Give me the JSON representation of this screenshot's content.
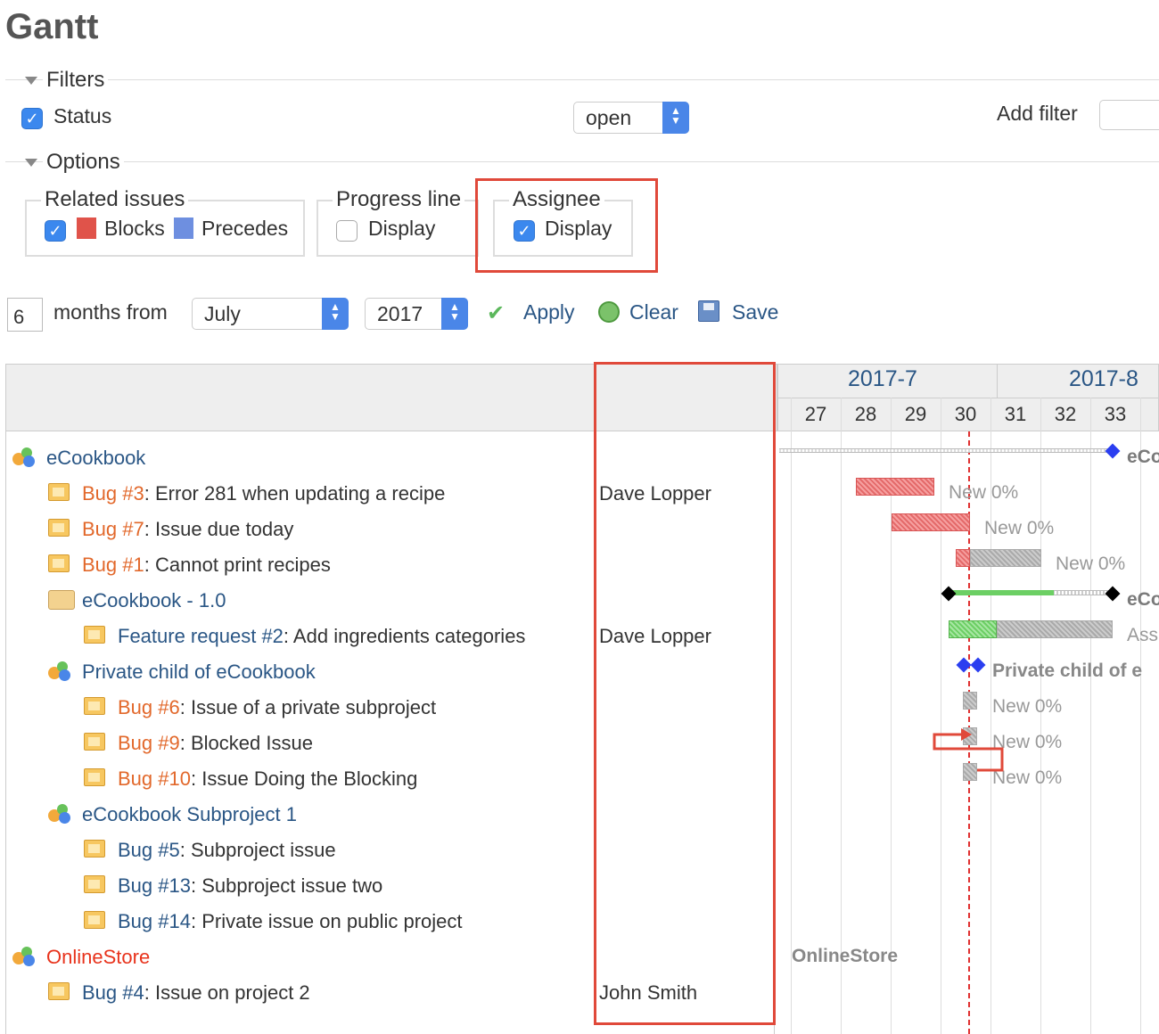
{
  "page": {
    "title": "Gantt"
  },
  "filters": {
    "legend": "Filters",
    "status_label": "Status",
    "status_operator": "open",
    "add_filter_label": "Add filter"
  },
  "options": {
    "legend": "Options",
    "related_issues": {
      "legend": "Related issues",
      "blocks": "Blocks",
      "precedes": "Precedes"
    },
    "progress_line": {
      "legend": "Progress line",
      "display": "Display"
    },
    "assignee": {
      "legend": "Assignee",
      "display": "Display"
    }
  },
  "period": {
    "months": "6",
    "months_from_label": "months from",
    "month": "July",
    "year": "2017"
  },
  "actions": {
    "apply": "Apply",
    "clear": "Clear",
    "save": "Save"
  },
  "gantt": {
    "months": [
      "2017-7",
      "2017-8"
    ],
    "weeks": [
      "27",
      "28",
      "29",
      "30",
      "31",
      "32",
      "33",
      "3"
    ],
    "rows": [
      {
        "type": "project",
        "name": "eCookbook",
        "assignee": ""
      },
      {
        "type": "issue",
        "tracker": "Bug",
        "number": "#3",
        "subject": ": Error 281 when updating a recipe",
        "assignee": "Dave Lopper"
      },
      {
        "type": "issue",
        "tracker": "Bug",
        "number": "#7",
        "subject": ": Issue due today",
        "assignee": ""
      },
      {
        "type": "issue",
        "tracker": "Bug",
        "number": "#1",
        "subject": ": Cannot print recipes",
        "assignee": ""
      },
      {
        "type": "version",
        "name": "eCookbook - 1.0",
        "assignee": ""
      },
      {
        "type": "issue",
        "tracker": "Feature request",
        "number": "#2",
        "subject": ": Add ingredients categories",
        "assignee": "Dave Lopper"
      },
      {
        "type": "project",
        "name": "Private child of eCookbook",
        "assignee": ""
      },
      {
        "type": "issue",
        "tracker": "Bug",
        "number": "#6",
        "subject": ": Issue of a private subproject",
        "assignee": ""
      },
      {
        "type": "issue",
        "tracker": "Bug",
        "number": "#9",
        "subject": ": Blocked Issue",
        "assignee": ""
      },
      {
        "type": "issue",
        "tracker": "Bug",
        "number": "#10",
        "subject": ": Issue Doing the Blocking",
        "assignee": ""
      },
      {
        "type": "project",
        "name": "eCookbook Subproject 1",
        "assignee": ""
      },
      {
        "type": "issue",
        "tracker": "Bug",
        "number": "#5",
        "subject": ": Subproject issue",
        "assignee": ""
      },
      {
        "type": "issue",
        "tracker": "Bug",
        "number": "#13",
        "subject": ": Subproject issue two",
        "assignee": ""
      },
      {
        "type": "issue",
        "tracker": "Bug",
        "number": "#14",
        "subject": ": Private issue on public project",
        "assignee": ""
      },
      {
        "type": "project",
        "name": "OnlineStore",
        "assignee": ""
      },
      {
        "type": "issue",
        "tracker": "Bug",
        "number": "#4",
        "subject": ": Issue on project 2",
        "assignee": "John Smith"
      }
    ],
    "bar_labels": {
      "project_ecookbook": "eCo",
      "bug3": "New 0%",
      "bug7": "New 0%",
      "bug1": "New 0%",
      "version": "eCo",
      "feature2": "Ass",
      "private_child": "Private child of e",
      "bug6": "New 0%",
      "bug9": "New 0%",
      "bug10": "New 0%",
      "onlinestore": "OnlineStore"
    }
  },
  "colors": {
    "blocks": "#e0534a",
    "precedes": "#6e8fe0",
    "highlight": "#e0493a",
    "today_line": "#e03030"
  }
}
